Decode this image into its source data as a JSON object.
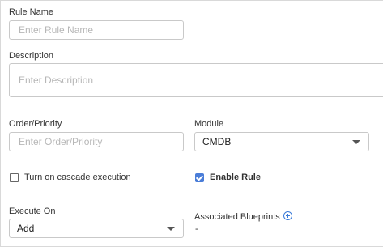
{
  "rule_name": {
    "label": "Rule Name",
    "placeholder": "Enter Rule Name"
  },
  "description": {
    "label": "Description",
    "placeholder": "Enter Description"
  },
  "order_priority": {
    "label": "Order/Priority",
    "placeholder": "Enter Order/Priority"
  },
  "module": {
    "label": "Module",
    "selected": "CMDB"
  },
  "cascade": {
    "label": "Turn on cascade execution",
    "checked": false
  },
  "enable_rule": {
    "label": "Enable Rule",
    "checked": true,
    "accent_color": "#4a7dd8"
  },
  "execute_on": {
    "label": "Execute On",
    "selected": "Add"
  },
  "associated_blueprints": {
    "label": "Associated Blueprints",
    "value": "-",
    "add_icon": "plus-circle-icon"
  }
}
